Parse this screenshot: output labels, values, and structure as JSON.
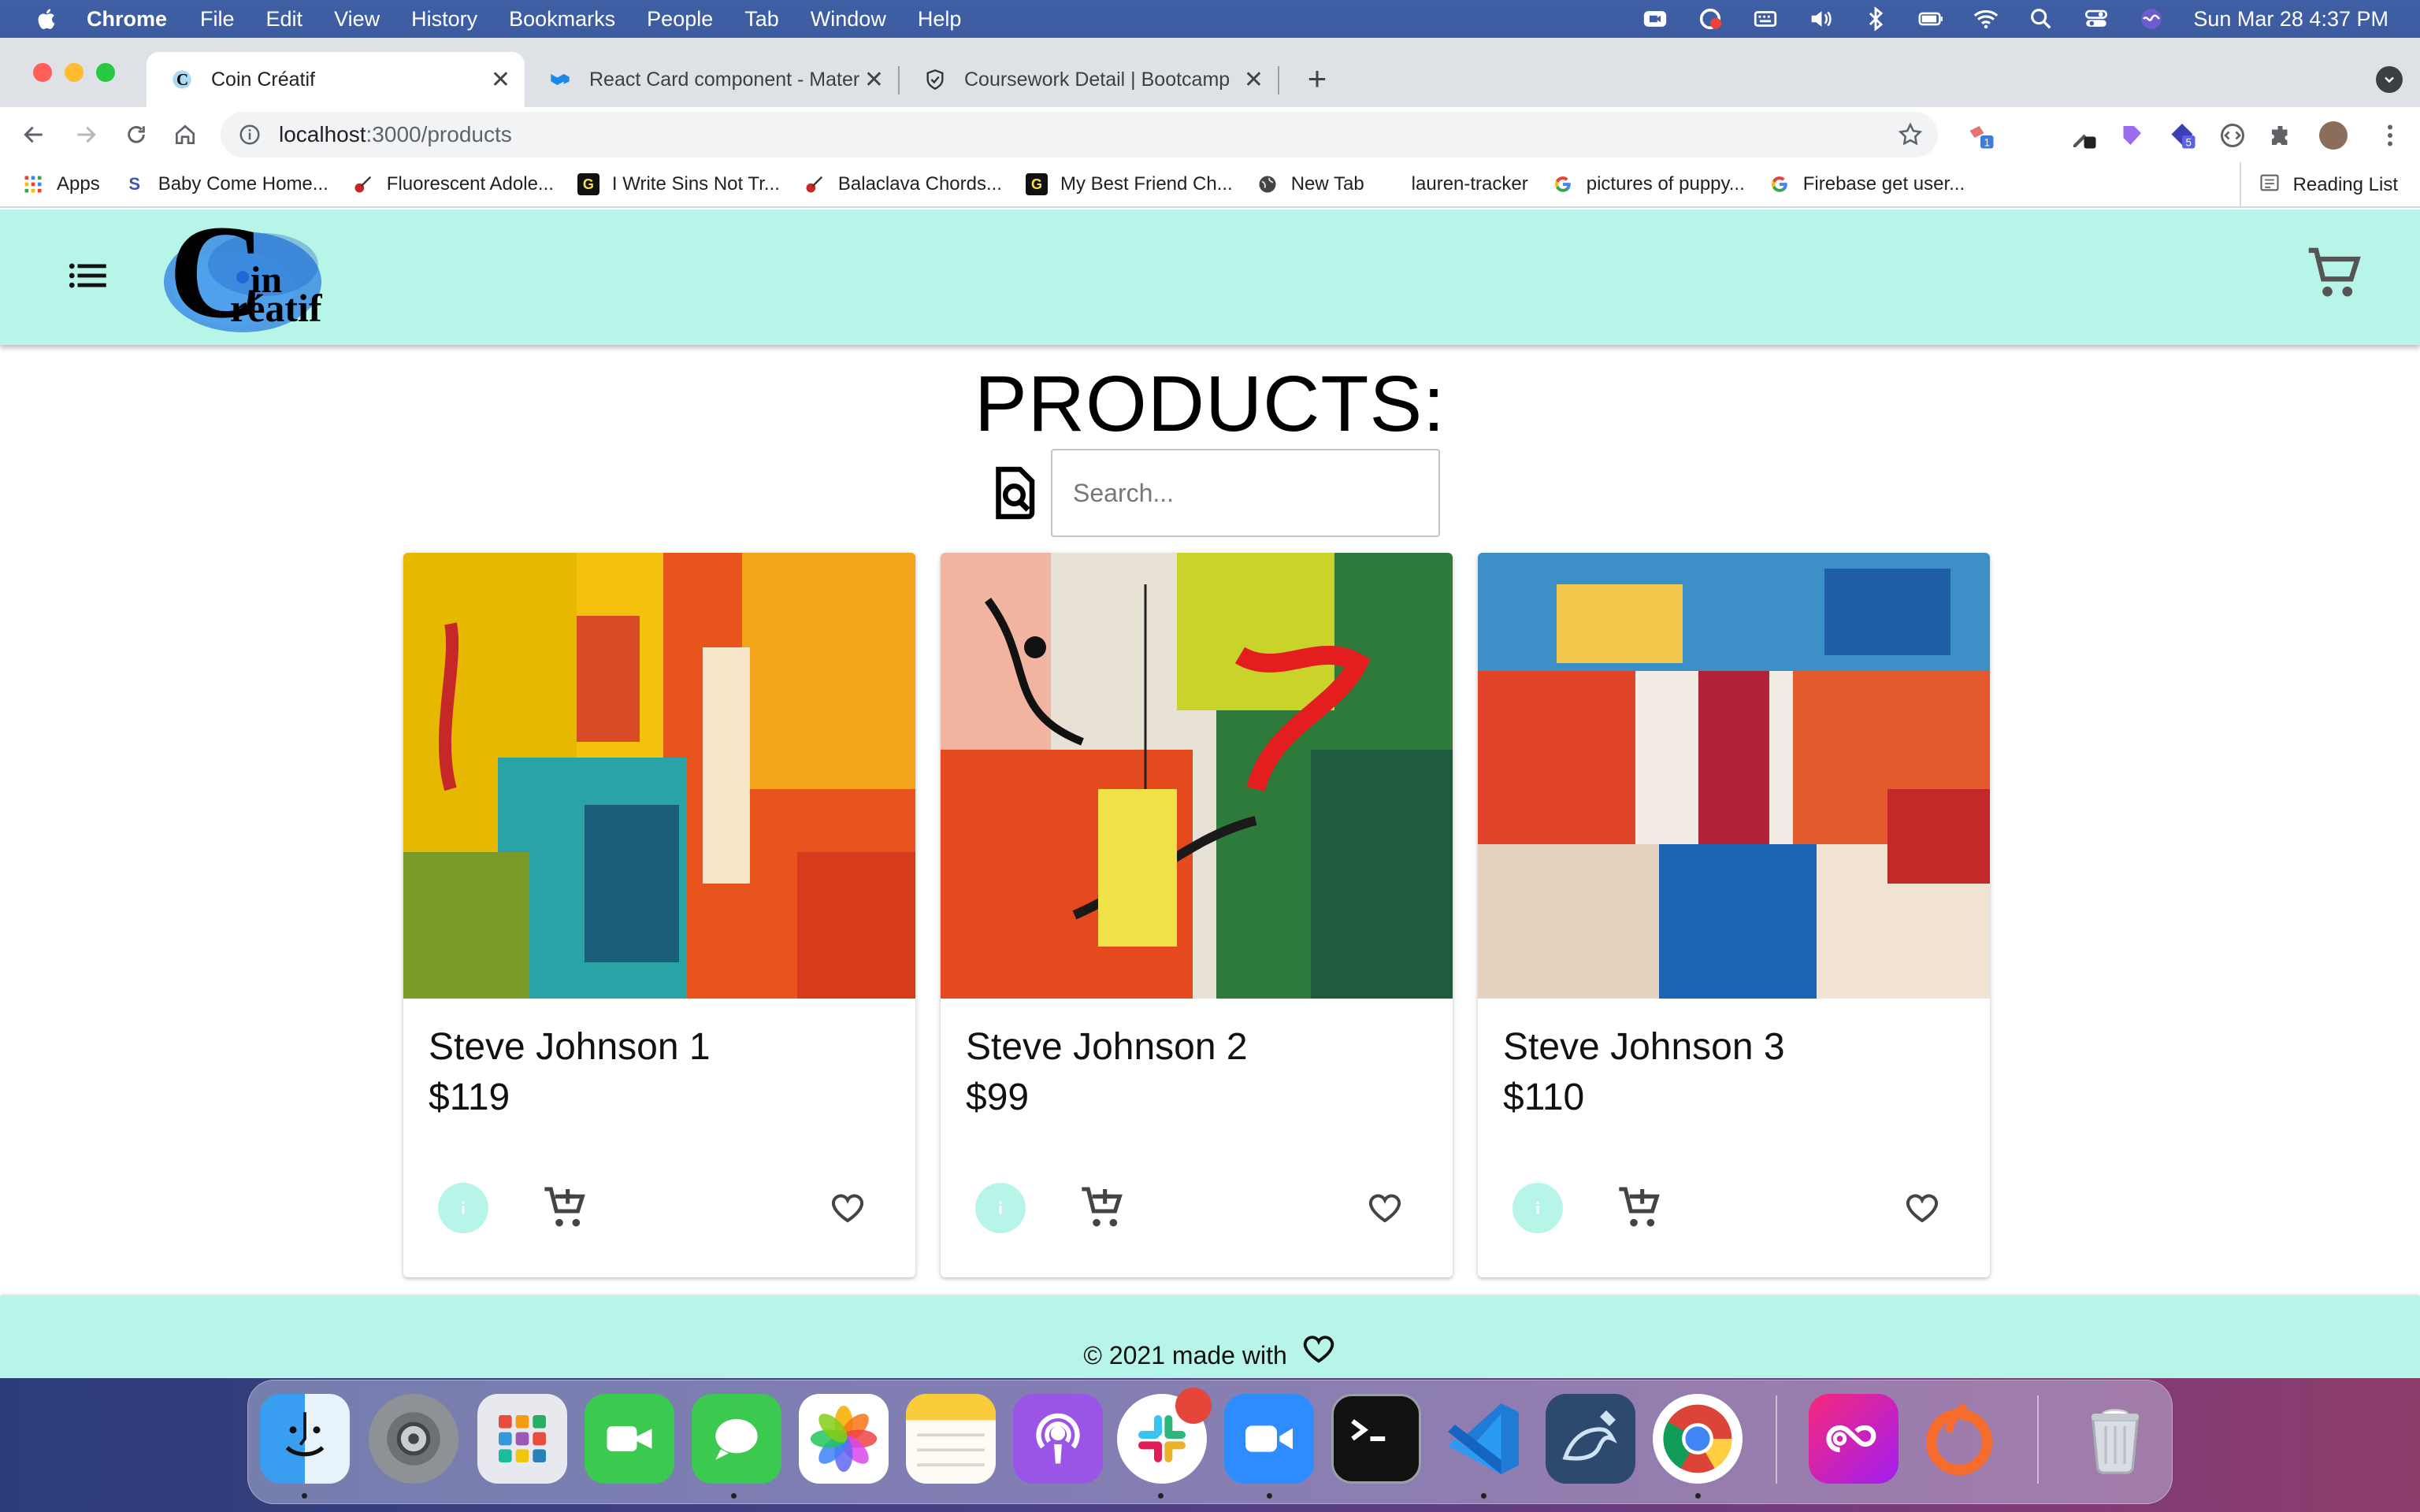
{
  "menubar": {
    "app_name": "Chrome",
    "items": [
      "File",
      "Edit",
      "View",
      "History",
      "Bookmarks",
      "People",
      "Tab",
      "Window",
      "Help"
    ],
    "clock": "Sun Mar 28  4:37 PM"
  },
  "tabs": [
    {
      "title": "Coin Créatif",
      "active": true
    },
    {
      "title": "React Card component - Mater",
      "active": false
    },
    {
      "title": "Coursework Detail | Bootcamp",
      "active": false
    }
  ],
  "omnibox": {
    "host": "localhost",
    "path": ":3000/products"
  },
  "bookmarks": {
    "items": [
      "Apps",
      "Baby Come Home...",
      "Fluorescent Adole...",
      "I Write Sins Not Tr...",
      "Balaclava Chords...",
      "My Best Friend Ch...",
      "New Tab",
      "lauren-tracker",
      "pictures of puppy...",
      "Firebase get user..."
    ],
    "reading_list": "Reading List"
  },
  "header": {
    "logo_main": "C",
    "logo_line1": "in",
    "logo_line2": "réatif"
  },
  "page": {
    "title": "PRODUCTS:",
    "search_placeholder": "Search..."
  },
  "products": [
    {
      "name": "Steve Johnson 1",
      "price": "$119"
    },
    {
      "name": "Steve Johnson 2",
      "price": "$99"
    },
    {
      "name": "Steve Johnson 3",
      "price": "$110"
    }
  ],
  "footer": {
    "text": "© 2021 made with"
  },
  "colors": {
    "header_bg": "#b8f5e9",
    "menubar_bg": "#3f5fa5",
    "tabstrip_bg": "#dee1e6"
  }
}
